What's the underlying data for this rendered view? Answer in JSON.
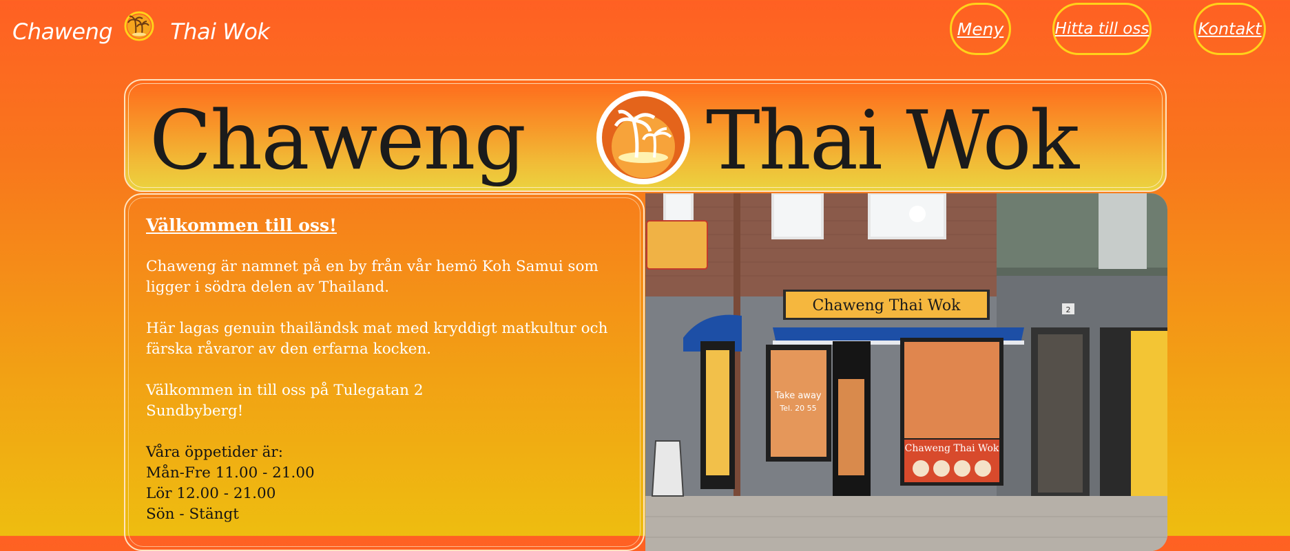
{
  "header": {
    "brand_left": "Chaweng",
    "brand_right": "Thai Wok",
    "nav": [
      {
        "label": "Meny"
      },
      {
        "label": "Hitta till oss"
      },
      {
        "label": "Kontakt"
      }
    ],
    "accent_color": "#ffd21a"
  },
  "banner": {
    "left_word": "Chaweng",
    "right_word": "Thai Wok"
  },
  "welcome": {
    "title": "Välkommen till oss!",
    "p1": "Chaweng är namnet på en by från vår hemö Koh Samui som ligger i södra delen av Thailand.",
    "p2": "Här lagas genuin thailändsk mat med kryddigt matkultur och färska råvaror av den erfarna kocken.",
    "p3_line1": "Välkommen in till oss på Tulegatan 2",
    "p3_line2": "Sundbyberg!",
    "hours_title": "Våra öppetider är:",
    "hours": [
      "Mån-Fre 11.00 - 21.00",
      "Lör 12.00 - 21.00",
      "Sön - Stängt"
    ]
  },
  "photo": {
    "sign_text": "Chaweng Thai Wok",
    "window_text": "Chaweng Thai Wok",
    "take_away": "Take away",
    "phone": "Tel. 20 55",
    "house_number": "2"
  },
  "colors": {
    "background_top": "#ff6023",
    "background_bottom": "#eebd10",
    "text": "#ffffff",
    "hours_text": "#141414"
  }
}
